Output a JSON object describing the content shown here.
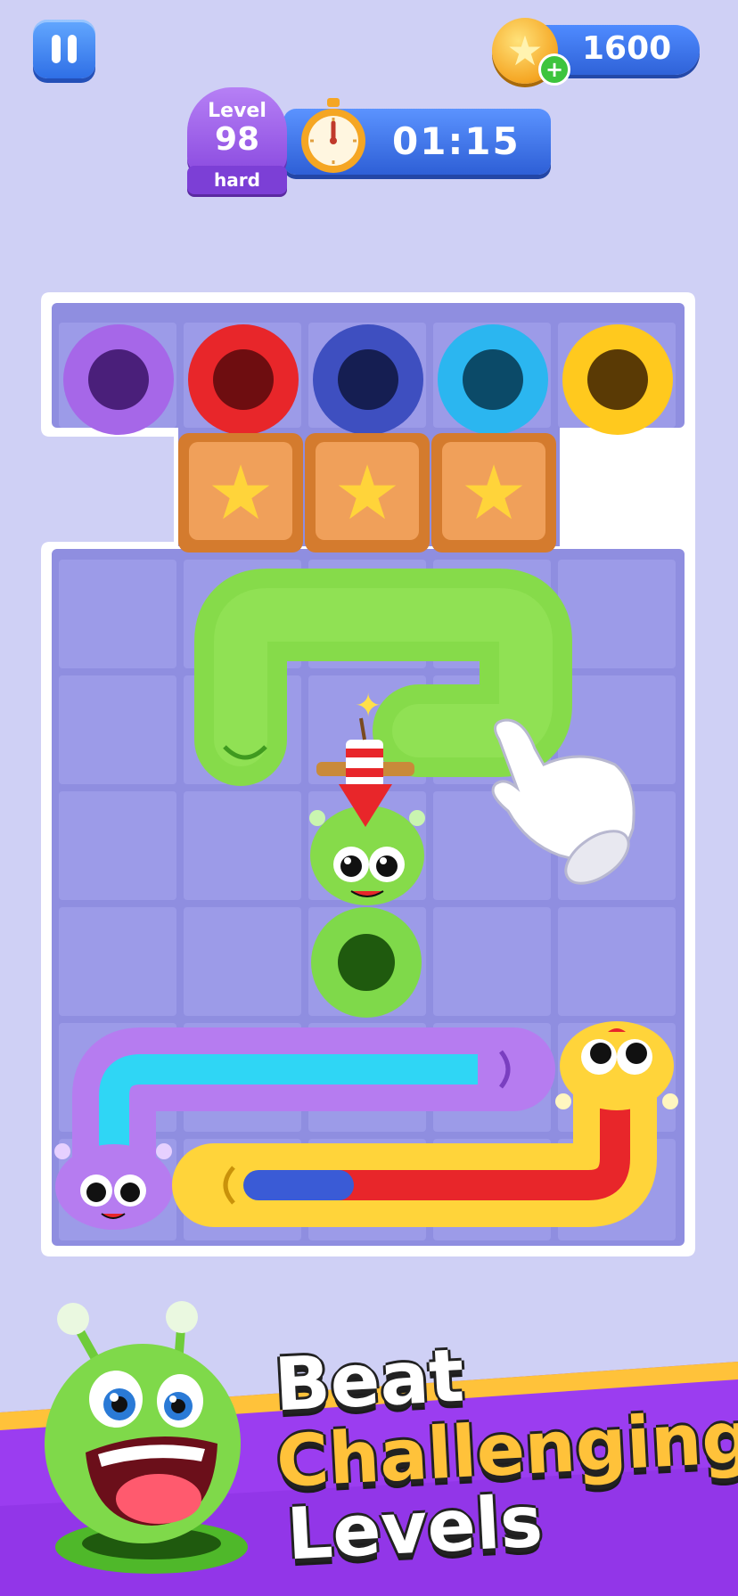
{
  "hud": {
    "coins": "1600",
    "coin_plus": "+",
    "timer": "01:15",
    "level_word": "Level",
    "level_number": "98",
    "difficulty": "hard"
  },
  "board": {
    "holes_top_row": [
      {
        "color": "purple",
        "fill": "#a667e8",
        "inner": "#4a1f7a"
      },
      {
        "color": "red",
        "fill": "#e8262a",
        "inner": "#6e0d10"
      },
      {
        "color": "navy",
        "fill": "#3e4fc0",
        "inner": "#151e52"
      },
      {
        "color": "cyan",
        "fill": "#2bb6f0",
        "inner": "#0b4a68"
      },
      {
        "color": "yellow",
        "fill": "#ffc91e",
        "inner": "#5a3a05"
      }
    ],
    "locked_crates": 3,
    "center_hole": {
      "color": "green",
      "fill": "#7fd94a",
      "inner": "#1f5a0e"
    },
    "worms": [
      {
        "name": "green-worm",
        "color": "#86db4a",
        "has_firecracker": true
      },
      {
        "name": "purple-worm",
        "color": "#b67cf0",
        "stripe": "#2fd6f5"
      },
      {
        "name": "yellow-worm",
        "color": "#ffd43a",
        "stripe": [
          "#3a5bd6",
          "#e8262a"
        ]
      }
    ],
    "hint": "tap-hand"
  },
  "banner": {
    "line1": "Beat",
    "line2": "Challenging",
    "line3": "Levels",
    "colors": {
      "bg": "#9b3df0",
      "stripe": "#ffc23a",
      "line2": "#ffc23a"
    }
  }
}
